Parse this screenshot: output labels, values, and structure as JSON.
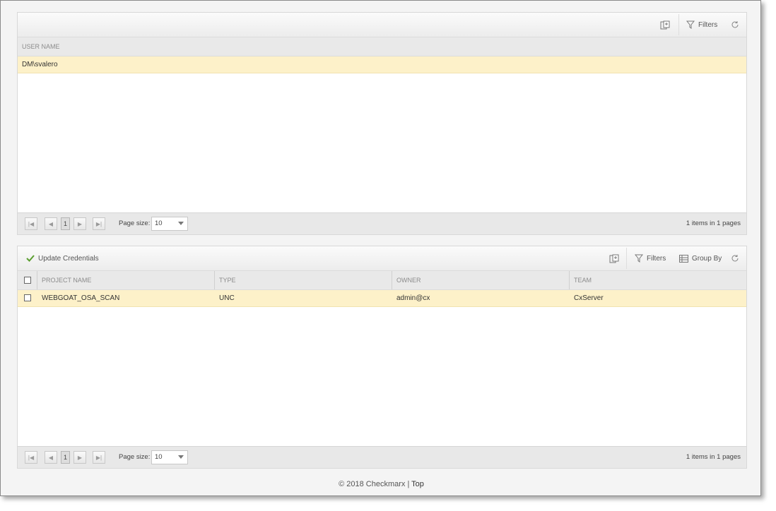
{
  "users_panel": {
    "toolbar": {
      "filters_label": "Filters"
    },
    "columns": [
      "USER NAME"
    ],
    "rows": [
      {
        "user_name": "DM\\svalero"
      }
    ],
    "pager": {
      "current_page": "1",
      "page_size_label": "Page size:",
      "page_size": "10",
      "items_info": "1 items in 1 pages"
    }
  },
  "projects_panel": {
    "toolbar": {
      "update_label": "Update Credentials",
      "filters_label": "Filters",
      "group_by_label": "Group By"
    },
    "columns": {
      "project_name": "PROJECT NAME",
      "type": "TYPE",
      "owner": "OWNER",
      "team": "TEAM"
    },
    "rows": [
      {
        "project_name": "WEBGOAT_OSA_SCAN",
        "type": "UNC",
        "owner": "admin@cx",
        "team": "CxServer"
      }
    ],
    "pager": {
      "current_page": "1",
      "page_size_label": "Page size:",
      "page_size": "10",
      "items_info": "1 items in 1 pages"
    }
  },
  "footer": {
    "copyright": "© 2018 Checkmarx",
    "separator": " | ",
    "top_link": "Top"
  },
  "colors": {
    "selected_row": "#fdf1c9",
    "accent_check": "#5a9e2f"
  }
}
